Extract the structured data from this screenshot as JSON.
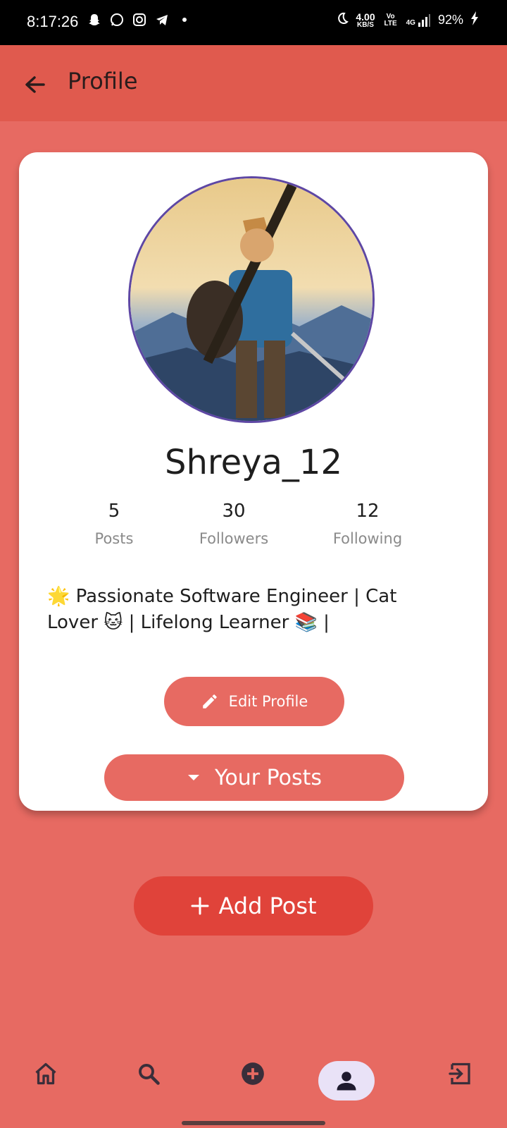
{
  "status_bar": {
    "time": "8:17:26",
    "speed": "4.00",
    "speed_unit": "KB/S",
    "volte": "Vo LTE",
    "network": "4G",
    "battery": "92%",
    "icons_left": [
      "snapchat-icon",
      "whatsapp-icon",
      "instagram-icon",
      "telegram-icon",
      "dot-icon"
    ],
    "icons_right": [
      "moon-icon",
      "signal-icon",
      "charging-icon"
    ]
  },
  "appbar": {
    "title": "Profile"
  },
  "profile": {
    "username": "Shreya_12",
    "stats": [
      {
        "value": "5",
        "label": "Posts"
      },
      {
        "value": "30",
        "label": "Followers"
      },
      {
        "value": "12",
        "label": "Following"
      }
    ],
    "bio": " 🌟 Passionate Software Engineer | Cat Lover 🐱 | Lifelong Learner 📚 |"
  },
  "buttons": {
    "edit_profile": "Edit Profile",
    "your_posts": "Your Posts",
    "add_post": "Add Post"
  },
  "bottom_nav": {
    "items": [
      "home-icon",
      "search-icon",
      "add-circle-icon",
      "person-icon",
      "logout-icon"
    ],
    "active": "person-icon"
  },
  "colors": {
    "background": "#E76A62",
    "appbar": "#E05A4E",
    "add_post": "#E0433A",
    "avatar_border": "#5E47A4",
    "nav_active": "#E9E2F7"
  }
}
